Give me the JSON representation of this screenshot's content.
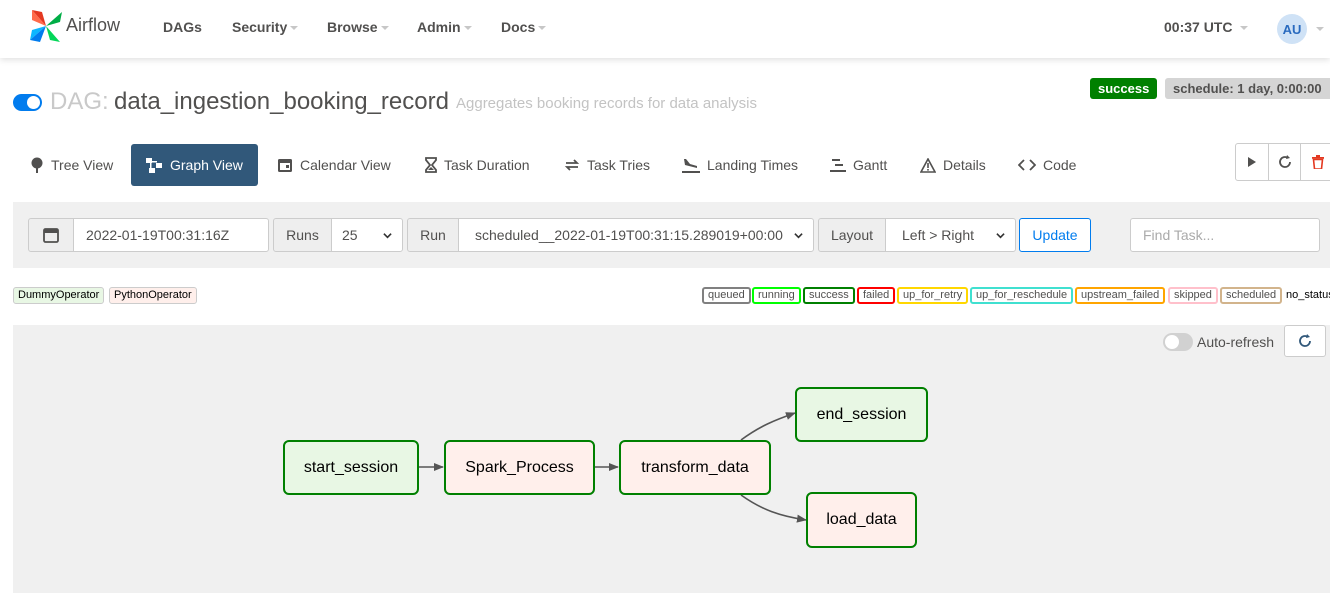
{
  "navbar": {
    "brand": "Airflow",
    "menu": [
      {
        "label": "DAGs"
      },
      {
        "label": "Security"
      },
      {
        "label": "Browse"
      },
      {
        "label": "Admin"
      },
      {
        "label": "Docs"
      }
    ],
    "time": "00:37 UTC",
    "avatar_initials": "AU"
  },
  "dag": {
    "prefix": "DAG:",
    "name": "data_ingestion_booking_record",
    "description": "Aggregates booking records for data analysis",
    "state_badge": "success",
    "schedule_badge": "schedule: 1 day, 0:00:00",
    "paused": false
  },
  "tabs": [
    {
      "label": "Tree View",
      "icon": "tree-icon"
    },
    {
      "label": "Graph View",
      "icon": "graph-icon",
      "active": true
    },
    {
      "label": "Calendar View",
      "icon": "calendar-icon"
    },
    {
      "label": "Task Duration",
      "icon": "hourglass-icon"
    },
    {
      "label": "Task Tries",
      "icon": "retry-icon"
    },
    {
      "label": "Landing Times",
      "icon": "plane-landing-icon"
    },
    {
      "label": "Gantt",
      "icon": "gantt-icon"
    },
    {
      "label": "Details",
      "icon": "warning-triangle-icon"
    },
    {
      "label": "Code",
      "icon": "code-icon"
    }
  ],
  "actions": [
    {
      "icon": "play-icon"
    },
    {
      "icon": "refresh-icon"
    },
    {
      "icon": "trash-icon"
    }
  ],
  "filters": {
    "base_date": "2022-01-19T00:31:16Z",
    "runs_label": "Runs",
    "runs_value": "25",
    "run_label": "Run",
    "run_value": "scheduled__2022-01-19T00:31:15.289019+00:00",
    "layout_label": "Layout",
    "layout_value": "Left > Right",
    "update_button": "Update",
    "find_task_placeholder": "Find Task..."
  },
  "operator_legend": [
    {
      "label": "DummyOperator",
      "color": "#e8f7e4"
    },
    {
      "label": "PythonOperator",
      "color": "#ffefeb"
    }
  ],
  "state_legend": [
    {
      "label": "queued",
      "color": "#808080"
    },
    {
      "label": "running",
      "color": "#00ff00"
    },
    {
      "label": "success",
      "color": "#008000"
    },
    {
      "label": "failed",
      "color": "#ff0000"
    },
    {
      "label": "up_for_retry",
      "color": "#ffd700"
    },
    {
      "label": "up_for_reschedule",
      "color": "#40e0d0"
    },
    {
      "label": "upstream_failed",
      "color": "#ffa500"
    },
    {
      "label": "skipped",
      "color": "#ffc0cb"
    },
    {
      "label": "scheduled",
      "color": "#d2b48c"
    },
    {
      "label": "no_status",
      "color": "#000000"
    }
  ],
  "graph": {
    "auto_refresh_label": "Auto-refresh",
    "auto_refresh_on": false,
    "nodes": [
      {
        "id": "start_session",
        "label": "start_session",
        "operator": "DummyOperator",
        "state": "success"
      },
      {
        "id": "spark_process",
        "label": "Spark_Process",
        "operator": "PythonOperator",
        "state": "success"
      },
      {
        "id": "transform_data",
        "label": "transform_data",
        "operator": "PythonOperator",
        "state": "success"
      },
      {
        "id": "end_session",
        "label": "end_session",
        "operator": "DummyOperator",
        "state": "success"
      },
      {
        "id": "load_data",
        "label": "load_data",
        "operator": "PythonOperator",
        "state": "success"
      }
    ],
    "edges": [
      [
        "start_session",
        "spark_process"
      ],
      [
        "spark_process",
        "transform_data"
      ],
      [
        "transform_data",
        "end_session"
      ],
      [
        "transform_data",
        "load_data"
      ]
    ]
  }
}
